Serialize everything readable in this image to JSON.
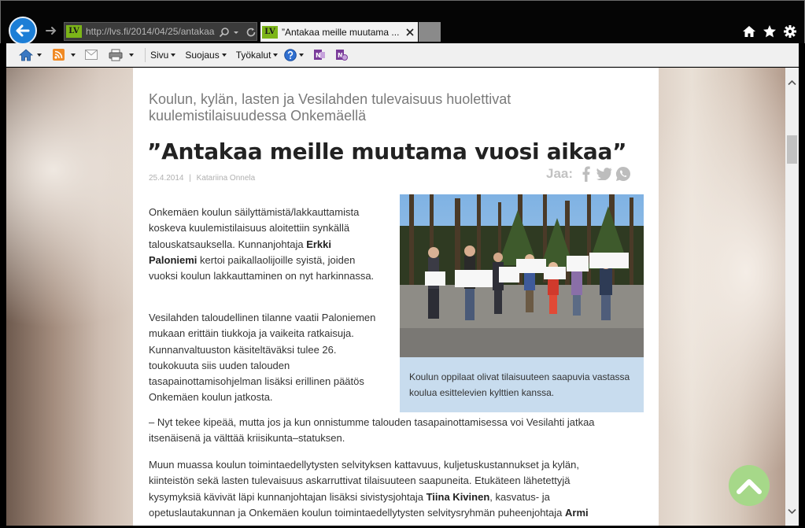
{
  "browser": {
    "address_url": "http://lvs.fi/2014/04/25/antakaa",
    "site_logo_text": "LV",
    "tab_title": "”Antakaa meille muutama ...",
    "accent_color": "#1c7ed6",
    "nav_icons": [
      "back-arrow-icon",
      "forward-arrow-icon",
      "search-icon",
      "dropdown-icon",
      "refresh-icon",
      "close-icon",
      "home-icon",
      "favorites-star-icon",
      "settings-gear-icon"
    ]
  },
  "commandbar": {
    "items": [
      {
        "label": "Sivu"
      },
      {
        "label": "Suojaus"
      },
      {
        "label": "Työkalut"
      }
    ],
    "icons": [
      "home-icon",
      "rss-feed-icon",
      "mail-icon",
      "print-icon",
      "help-icon",
      "onenote-icon",
      "onenote-linked-icon"
    ]
  },
  "article": {
    "kicker": "Koulun, kylän, lasten ja Vesilahden tulevaisuus huolettivat kuulemistilaisuudessa Onkemäellä",
    "headline": "”Antakaa meille muutama vuosi aikaa”",
    "date": "25.4.2014",
    "meta_sep": "|",
    "author": "Katariina Onnela",
    "share_label": "Jaa:",
    "share_icons": [
      "facebook-icon",
      "twitter-icon",
      "whatsapp-icon"
    ],
    "photo_caption": "Koulun oppilaat olivat tilaisuuteen saapuvia vastassa koulua esittelevien kylttien kanssa.",
    "p1": {
      "a": "Onkemäen koulun säilyttämistä/lakkauttamista koskeva kuulemistilaisuus aloitettiin synkällä talouskatsauksella. Kunnanjohtaja ",
      "b": "Erkki Paloniemi",
      "c": " kertoi paikallaolijoille syistä, joiden vuoksi koulun lakkauttaminen on  nyt harkinnassa."
    },
    "p2": "Vesilahden taloudellinen tilanne vaatii Paloniemen mukaan erittäin tiukkoja ja vaikeita ratkaisuja. Kunnanvaltuuston käsiteltäväksi tulee 26. toukokuuta siis uuden talouden tasapainottamisohjelman lisäksi erillinen päätös Onkemäen koulun jatkosta.",
    "p3": "– Nyt tekee kipeää, mutta jos ja kun onnistumme talouden tasapainottamisessa voi Vesilahti jatkaa itsenäisenä ja välttää kriisikunta–statuksen.",
    "p4": {
      "a": "Muun muassa koulun toimintaedellytysten selvityksen kattavuus, kuljetuskustannukset ja kylän, kiinteistön sekä lasten tulevaisuus askarruttivat tilaisuuteen saapuneita. Etukäteen lähetettyjä kysymyksiä kävivät läpi kunnanjohtajan lisäksi sivistysjohtaja ",
      "b": "Tiina Kivinen",
      "c": ", kasvatus- ja opetuslautakunnan ja Onkemäen koulun toimintaedellytysten selvitysryhmän puheenjohtaja ",
      "d": "Armi"
    }
  }
}
